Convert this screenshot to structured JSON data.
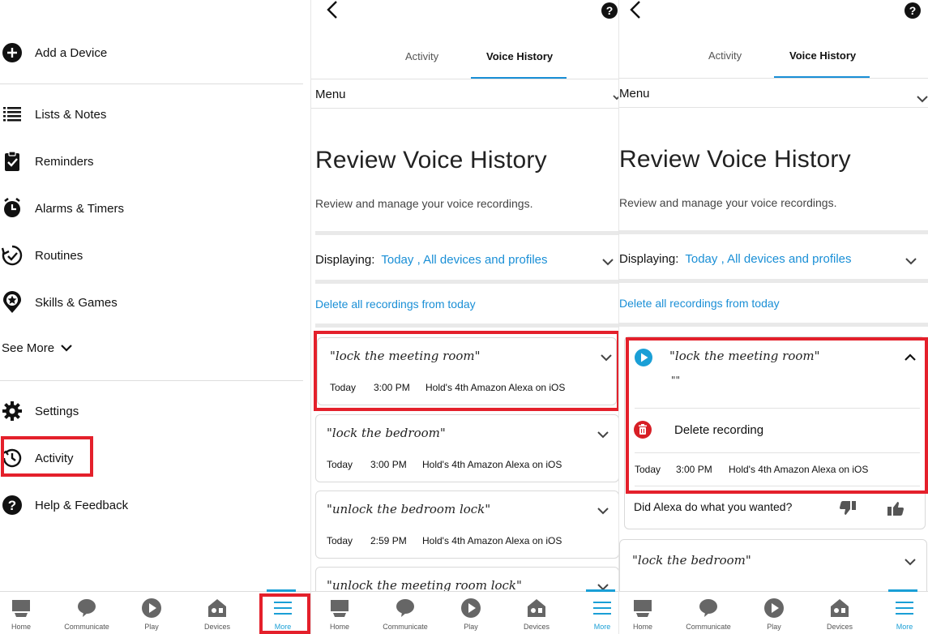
{
  "left_menu": {
    "items": [
      {
        "icon": "plus-circle-icon",
        "label": "Add a Device"
      },
      {
        "icon": "list-icon",
        "label": "Lists & Notes"
      },
      {
        "icon": "clipboard-check-icon",
        "label": "Reminders"
      },
      {
        "icon": "alarm-clock-icon",
        "label": "Alarms & Timers"
      },
      {
        "icon": "routine-icon",
        "label": "Routines"
      },
      {
        "icon": "skills-pin-icon",
        "label": "Skills & Games"
      },
      {
        "icon": "gear-icon",
        "label": "Settings"
      },
      {
        "icon": "history-clock-icon",
        "label": "Activity"
      },
      {
        "icon": "help-circle-icon",
        "label": "Help & Feedback"
      }
    ],
    "see_more": "See More"
  },
  "bottom_nav": {
    "items": [
      "Home",
      "Communicate",
      "Play",
      "Devices",
      "More"
    ],
    "active": "More"
  },
  "voice_history": {
    "tabs": [
      "Activity",
      "Voice History"
    ],
    "active_tab": "Voice History",
    "menu_label": "Menu",
    "title": "Review Voice History",
    "subtitle": "Review and manage your voice recordings.",
    "displaying_label": "Displaying:",
    "displaying_value": "Today , All devices and profiles",
    "delete_all": "Delete all recordings from today"
  },
  "recordings_panel2": [
    {
      "quote": "\"lock the meeting room\"",
      "day": "Today",
      "time": "3:00 PM",
      "device": "Hold's 4th Amazon Alexa on iOS"
    },
    {
      "quote": "\"lock the bedroom\"",
      "day": "Today",
      "time": "3:00 PM",
      "device": "Hold's 4th Amazon Alexa on iOS"
    },
    {
      "quote": "\"unlock the bedroom lock\"",
      "day": "Today",
      "time": "2:59 PM",
      "device": "Hold's 4th Amazon Alexa on iOS"
    },
    {
      "quote": "\"unlock the meeting room lock\""
    }
  ],
  "expanded_recording": {
    "quote": "\"lock the meeting room\"",
    "transcript": "\"\"",
    "delete_label": "Delete recording",
    "day": "Today",
    "time": "3:00 PM",
    "device": "Hold's 4th Amazon Alexa on iOS",
    "feedback_question": "Did Alexa do what you wanted?",
    "next_quote": "\"lock the bedroom\""
  },
  "colors": {
    "accent": "#1a8fd6",
    "highlight": "#e4202b",
    "delete_red": "#d71f26"
  }
}
